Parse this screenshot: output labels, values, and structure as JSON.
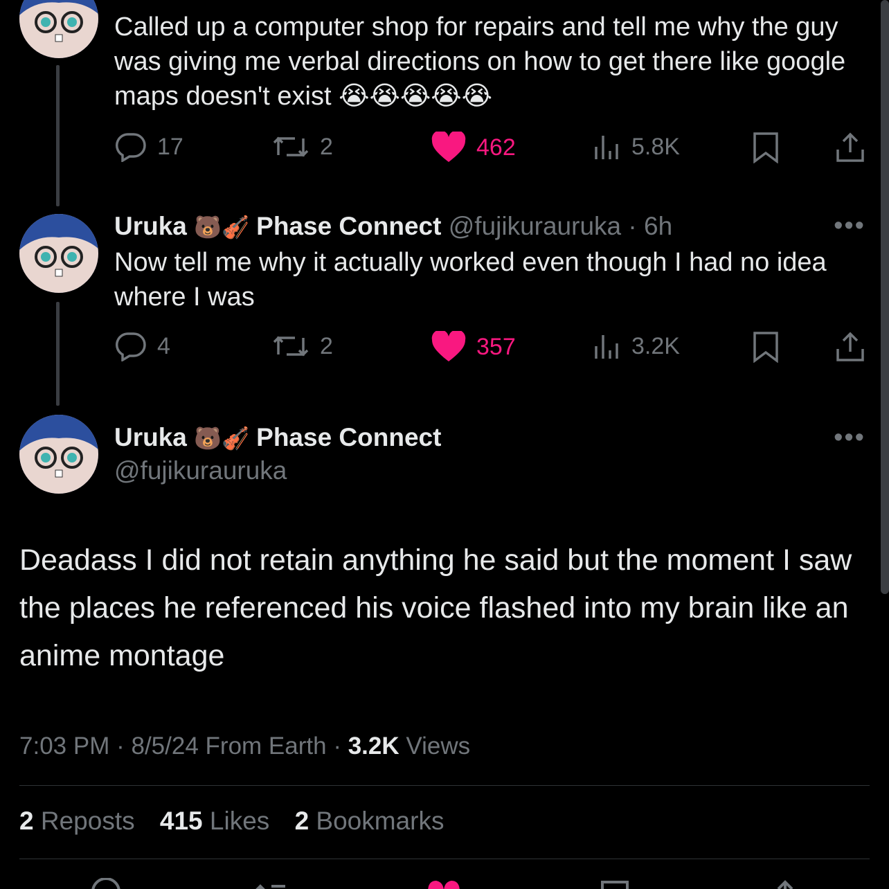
{
  "tweets": [
    {
      "text": "Called up a computer shop for repairs and tell me why the guy was giving me verbal directions on how to get there like google maps doesn't exist 😭😭😭😭😭",
      "replies": "17",
      "reposts": "2",
      "likes": "462",
      "views": "5.8K"
    },
    {
      "name": "Uruka",
      "emojis": "🐻🎻",
      "affiliation": "Phase Connect",
      "handle": "@fujikurauruka",
      "time": "· 6h",
      "text": "Now tell me why it actually worked even though I had no idea where I was",
      "replies": "4",
      "reposts": "2",
      "likes": "357",
      "views": "3.2K"
    }
  ],
  "main_tweet": {
    "name": "Uruka",
    "emojis": "🐻🎻",
    "affiliation": "Phase Connect",
    "handle": "@fujikurauruka",
    "text": "Deadass I did not retain anything he said but the moment I saw the places he referenced his voice flashed into my brain like an anime montage",
    "time": "7:03 PM",
    "date": "8/5/24",
    "location": "From Earth",
    "views_count": "3.2K",
    "views_label": "Views",
    "reposts_count": "2",
    "reposts_label": "Reposts",
    "likes_count": "415",
    "likes_label": "Likes",
    "bookmarks_count": "2",
    "bookmarks_label": "Bookmarks"
  },
  "icons": [
    "reply-icon",
    "repost-icon",
    "heart-icon",
    "views-icon",
    "bookmark-icon",
    "share-icon",
    "more-icon"
  ],
  "colors": {
    "background": "#000000",
    "text": "#e7e9ea",
    "muted": "#71767b",
    "like": "#f91880"
  }
}
